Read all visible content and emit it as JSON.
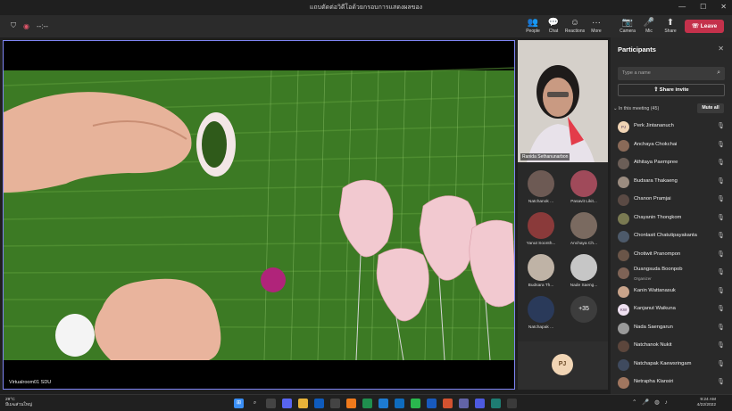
{
  "window": {
    "title": "แถบตัดต่อวิดีโอด้วยกรอบการแสดงผลของ",
    "minimize": "—",
    "maximize": "☐",
    "close": "✕"
  },
  "toolbar": {
    "timer": "--:--",
    "items": [
      {
        "label": "People",
        "icon": "👥"
      },
      {
        "label": "Chat",
        "icon": "💬"
      },
      {
        "label": "Reactions",
        "icon": "☺"
      },
      {
        "label": "More",
        "icon": "···"
      },
      {
        "label": "Camera",
        "icon": "📷"
      },
      {
        "label": "Mic",
        "icon": "🎤"
      },
      {
        "label": "Share",
        "icon": "⬆"
      }
    ],
    "leave": "Leave",
    "leave_color": "#c4314b"
  },
  "stage": {
    "label": "Virtualroom01 SDU"
  },
  "gallery": {
    "spotlight_name": "Ranida Sethanunarbon",
    "tiles": [
      {
        "name": "Natchanok ..."
      },
      {
        "name": "Pasavit Likit..."
      },
      {
        "name": "Yanut Soonth..."
      },
      {
        "name": "Anchaya Ch..."
      },
      {
        "name": "Budsara Th..."
      },
      {
        "name": "Nade Saeng..."
      },
      {
        "name": "Natchapak ..."
      }
    ],
    "more_count": "+35",
    "pj_initials": "PJ"
  },
  "panel": {
    "title": "Participants",
    "search_placeholder": "Type a name",
    "share_invite": "Share invite",
    "section": "In this meeting (45)",
    "mute_all": "Mute all",
    "participants": [
      {
        "name": "Perk Jintananuch",
        "initials": "PJ",
        "color": "#f1d5b5",
        "role": ""
      },
      {
        "name": "Anchaya Chokchai",
        "initials": "",
        "color": "#8a6a58",
        "role": ""
      },
      {
        "name": "Athitaya Paempree",
        "initials": "",
        "color": "#6b5e57",
        "role": ""
      },
      {
        "name": "Budsara Thakaeng",
        "initials": "",
        "color": "#9b8c80",
        "role": ""
      },
      {
        "name": "Chanon Pramjai",
        "initials": "",
        "color": "#5a4a44",
        "role": ""
      },
      {
        "name": "Chayanin Thongkom",
        "initials": "",
        "color": "#7a7a52",
        "role": ""
      },
      {
        "name": "Chonlasit Chatutipayakanta",
        "initials": "",
        "color": "#4d5a6a",
        "role": ""
      },
      {
        "name": "Chotiwit Pranompon",
        "initials": "",
        "color": "#6a5548",
        "role": ""
      },
      {
        "name": "Duangsuda Boonpob",
        "initials": "",
        "color": "#7e6356",
        "role": "Organizer"
      },
      {
        "name": "Kanin Wattanasuk",
        "initials": "",
        "color": "#c9a48b",
        "role": ""
      },
      {
        "name": "Kanjanut Waikuna",
        "initials": "KW",
        "color": "#eee0f0",
        "role": ""
      },
      {
        "name": "Nada Saengarun",
        "initials": "",
        "color": "#9a9a9a",
        "role": ""
      },
      {
        "name": "Natchanok Nukit",
        "initials": "",
        "color": "#5c463c",
        "role": ""
      },
      {
        "name": "Natchapak Kaewsringam",
        "initials": "",
        "color": "#3f4a5e",
        "role": ""
      },
      {
        "name": "Netrapha Klansiri",
        "initials": "",
        "color": "#a0765f",
        "role": ""
      }
    ]
  },
  "taskbar": {
    "temp": "29°C",
    "weather": "มีเมฆส่วนใหญ่",
    "time": "9:24 AM",
    "date": "4/22/2022"
  }
}
